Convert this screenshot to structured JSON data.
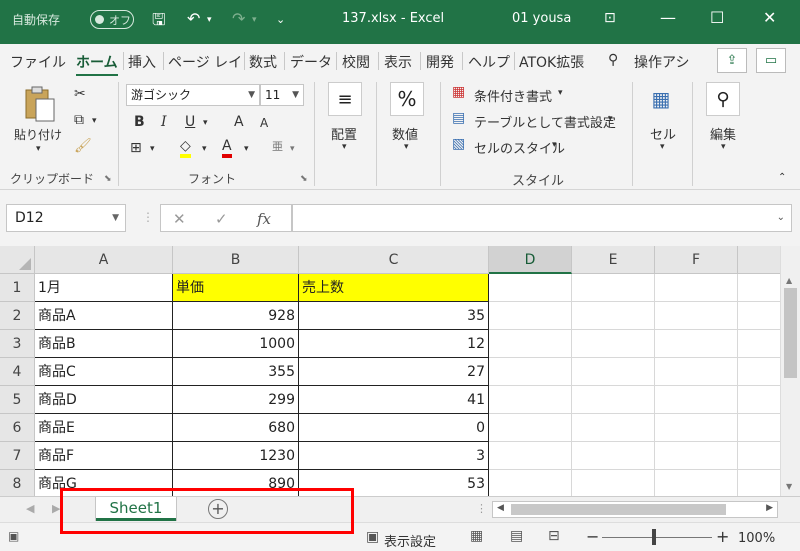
{
  "titlebar": {
    "autosave_label": "自動保存",
    "autosave_state": "オフ",
    "filename": "137.xlsx",
    "app": "Excel",
    "user": "01 yousa"
  },
  "tabs": [
    "ファイル",
    "ホーム",
    "挿入",
    "ページ レイ",
    "数式",
    "データ",
    "校閲",
    "表示",
    "開発",
    "ヘルプ",
    "ATOK拡張"
  ],
  "active_tab": "ホーム",
  "tell_me": "操作アシ",
  "ribbon": {
    "clipboard": {
      "paste_label": "貼り付け",
      "group_label": "クリップボード"
    },
    "font": {
      "font_name": "游ゴシック",
      "font_size": "11",
      "group_label": "フォント",
      "bold": "B",
      "italic": "I",
      "underline": "U",
      "font_color_glyph": "A",
      "grow": "A",
      "shrink": "A",
      "phonetic": "亜"
    },
    "alignment": {
      "label": "配置"
    },
    "number": {
      "label": "数値",
      "glyph": "%"
    },
    "styles": {
      "conditional": "条件付き書式",
      "as_table": "テーブルとして書式設定",
      "cell_styles": "セルのスタイル",
      "group_label": "スタイル"
    },
    "cells": {
      "label": "セル"
    },
    "editing": {
      "label": "編集"
    }
  },
  "formula_bar": {
    "name_box": "D12",
    "fx": "fx",
    "cancel": "✕",
    "enter": "✓",
    "formula": ""
  },
  "grid": {
    "columns": [
      "A",
      "B",
      "C",
      "D",
      "E",
      "F"
    ],
    "selected_column": "D",
    "rows": [
      {
        "num": "1",
        "a": "1月",
        "b": "単価",
        "c": "売上数"
      },
      {
        "num": "2",
        "a": "商品A",
        "b": "928",
        "c": "35"
      },
      {
        "num": "3",
        "a": "商品B",
        "b": "1000",
        "c": "12"
      },
      {
        "num": "4",
        "a": "商品C",
        "b": "355",
        "c": "27"
      },
      {
        "num": "5",
        "a": "商品D",
        "b": "299",
        "c": "41"
      },
      {
        "num": "6",
        "a": "商品E",
        "b": "680",
        "c": "0"
      },
      {
        "num": "7",
        "a": "商品F",
        "b": "1230",
        "c": "3"
      },
      {
        "num": "8",
        "a": "商品G",
        "b": "890",
        "c": "53"
      }
    ],
    "header_fill": "#ffff00"
  },
  "sheets": {
    "active": "Sheet1"
  },
  "status": {
    "display_settings": "表示設定",
    "zoom": "100%"
  },
  "colors": {
    "brand": "#217346",
    "highlight": "#ff0000"
  }
}
